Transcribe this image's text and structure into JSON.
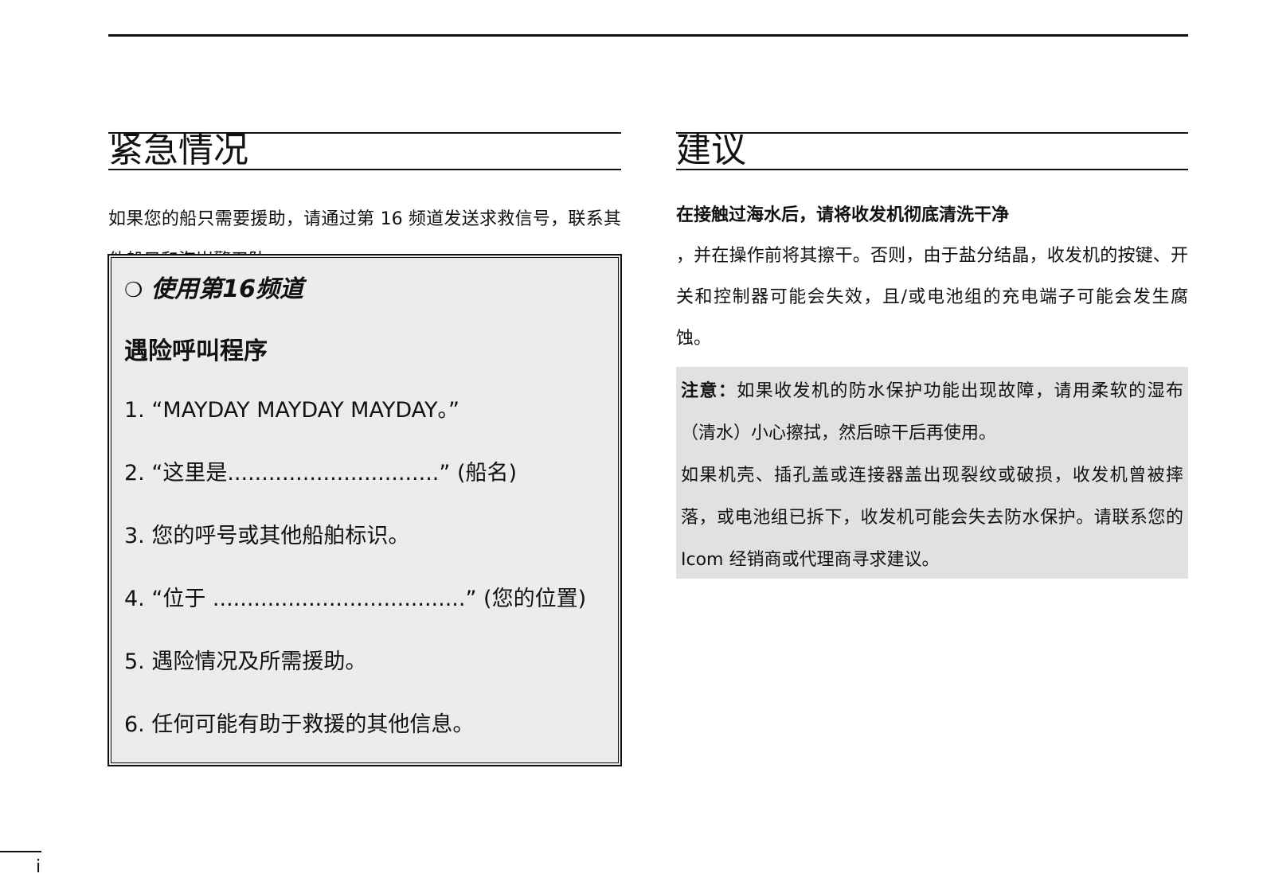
{
  "left_section": {
    "title": "紧急情况",
    "intro": "如果您的船只需要援助，请通过第 16 频道发送求救信号，联系其他船只和海岸警卫队。",
    "box": {
      "bullet": "❍",
      "header": "使用第16频道",
      "subtitle": "遇险呼叫程序",
      "steps": [
        "1. “MAYDAY MAYDAY MAYDAY。”",
        "2. “这里是...............................” (船名)",
        "3. 您的呼号或其他船舶标识。",
        "4. “位于 .....................................” (您的位置)",
        "5. 遇险情况及所需援助。",
        "6. 任何可能有助于救援的其他信息。"
      ]
    }
  },
  "right_section": {
    "title": "建议",
    "bold_line": "在接触过海水后，请将收发机彻底清洗干净",
    "body": "，并在操作前将其擦干。否则，由于盐分结晶，收发机的按键、开关和控制器可能会失效，且/或电池组的充电端子可能会发生腐蚀。",
    "note": {
      "label": "注意：",
      "text1": "如果收发机的防水保护功能出现故障，请用柔软的湿布（清水）小心擦拭，然后晾干后再使用。",
      "text2": "如果机壳、插孔盖或连接器盖出现裂纹或破损，收发机曾被摔落，或电池组已拆下，收发机可能会失去防水保护。请联系您的 Icom 经销商或代理商寻求建议。"
    }
  },
  "footer": {
    "page_number": "i"
  }
}
